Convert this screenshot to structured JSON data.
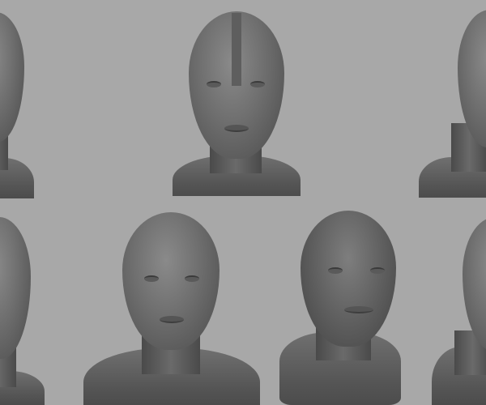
{
  "scene": {
    "background_color": "#a8a8a8",
    "sculpt_color": "#6e6e6e",
    "busts": [
      "top-left",
      "top-center",
      "top-right",
      "bottom-left",
      "bottom-center-left",
      "bottom-center-right",
      "bottom-right"
    ]
  }
}
